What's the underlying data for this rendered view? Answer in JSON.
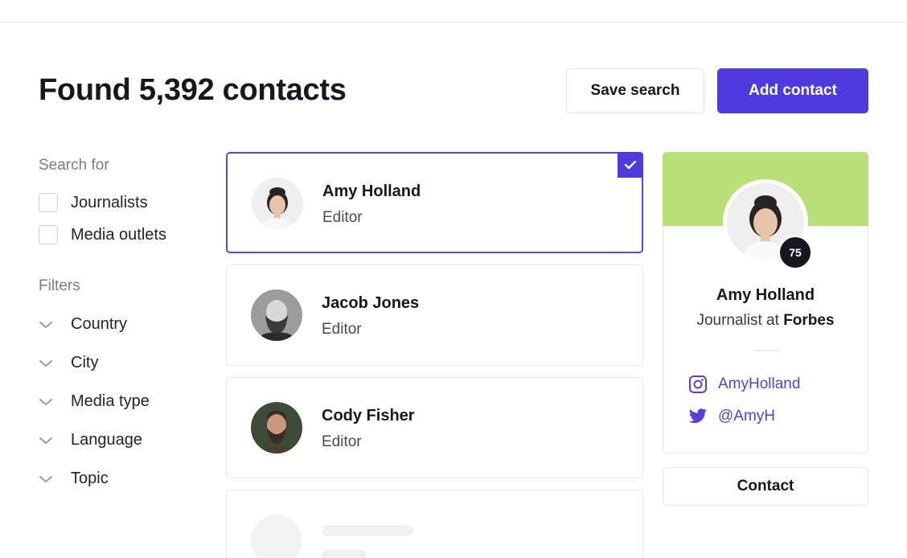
{
  "header": {
    "title": "Found 5,392 contacts",
    "save_search_label": "Save search",
    "add_contact_label": "Add contact"
  },
  "sidebar": {
    "search_for_label": "Search for",
    "search_options": [
      {
        "label": "Journalists",
        "checked": false
      },
      {
        "label": "Media outlets",
        "checked": false
      }
    ],
    "filters_label": "Filters",
    "filters": [
      {
        "label": "Country"
      },
      {
        "label": "City"
      },
      {
        "label": "Media type"
      },
      {
        "label": "Language"
      },
      {
        "label": "Topic"
      }
    ]
  },
  "contacts": [
    {
      "name": "Amy Holland",
      "role": "Editor",
      "selected": true
    },
    {
      "name": "Jacob Jones",
      "role": "Editor",
      "selected": false
    },
    {
      "name": "Cody Fisher",
      "role": "Editor",
      "selected": false
    }
  ],
  "profile": {
    "name": "Amy Holland",
    "job_prefix": "Journalist at",
    "company": "Forbes",
    "score": "75",
    "instagram": "AmyHolland",
    "twitter": "@AmyH",
    "contact_label": "Contact"
  },
  "colors": {
    "accent": "#4f3ae0",
    "banner": "#b8e076",
    "link": "#5640d6"
  }
}
